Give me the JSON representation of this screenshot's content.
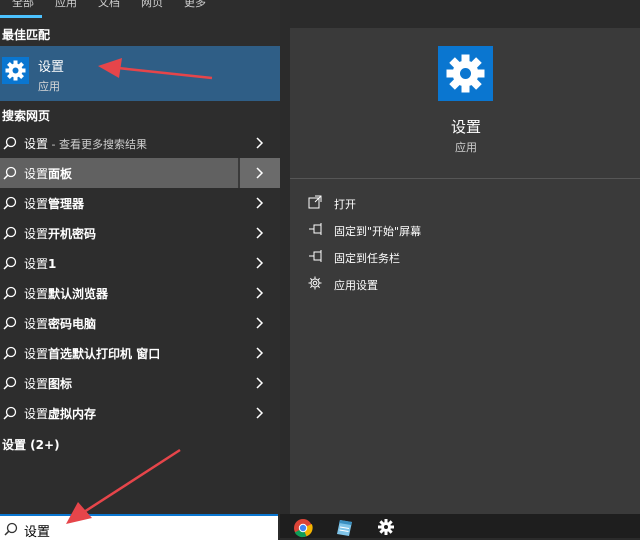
{
  "colors": {
    "accent": "#0a76d0",
    "best_match_bg": "#2f5e86",
    "arrow": "#e6454a"
  },
  "tabs": [
    {
      "label": "全部",
      "active": true
    },
    {
      "label": "应用"
    },
    {
      "label": "文档"
    },
    {
      "label": "网页"
    },
    {
      "label": "更多"
    }
  ],
  "sections": {
    "best_match": "最佳匹配",
    "web": "搜索网页",
    "settings": "设置 (2+)"
  },
  "best_match": {
    "title": "设置",
    "subtitle": "应用",
    "icon": "gear-icon"
  },
  "web_results": [
    {
      "prefix": "设置",
      "bold": "",
      "hint": " - 查看更多搜索结果",
      "selected": false
    },
    {
      "prefix": "设置",
      "bold": "面板",
      "hint": "",
      "selected": true
    },
    {
      "prefix": "设置",
      "bold": "管理器",
      "hint": "",
      "selected": false
    },
    {
      "prefix": "设置",
      "bold": "开机密码",
      "hint": "",
      "selected": false
    },
    {
      "prefix": "设置",
      "bold": "1",
      "hint": "",
      "selected": false
    },
    {
      "prefix": "设置",
      "bold": "默认浏览器",
      "hint": "",
      "selected": false
    },
    {
      "prefix": "设置",
      "bold": "密码电脑",
      "hint": "",
      "selected": false
    },
    {
      "prefix": "设置",
      "bold": "首选默认打印机 窗口",
      "hint": "",
      "selected": false
    },
    {
      "prefix": "设置",
      "bold": "图标",
      "hint": "",
      "selected": false
    },
    {
      "prefix": "设置",
      "bold": "虚拟内存",
      "hint": "",
      "selected": false
    }
  ],
  "search": {
    "value": "设置"
  },
  "detail": {
    "title": "设置",
    "subtitle": "应用",
    "actions": [
      {
        "label": "打开",
        "icon": "open-icon"
      },
      {
        "label": "固定到\"开始\"屏幕",
        "icon": "pin-icon"
      },
      {
        "label": "固定到任务栏",
        "icon": "pin-icon"
      },
      {
        "label": "应用设置",
        "icon": "gear-icon"
      }
    ]
  },
  "taskbar": [
    {
      "icon": "chrome-icon"
    },
    {
      "icon": "notepad-icon"
    },
    {
      "icon": "gear-icon"
    }
  ]
}
